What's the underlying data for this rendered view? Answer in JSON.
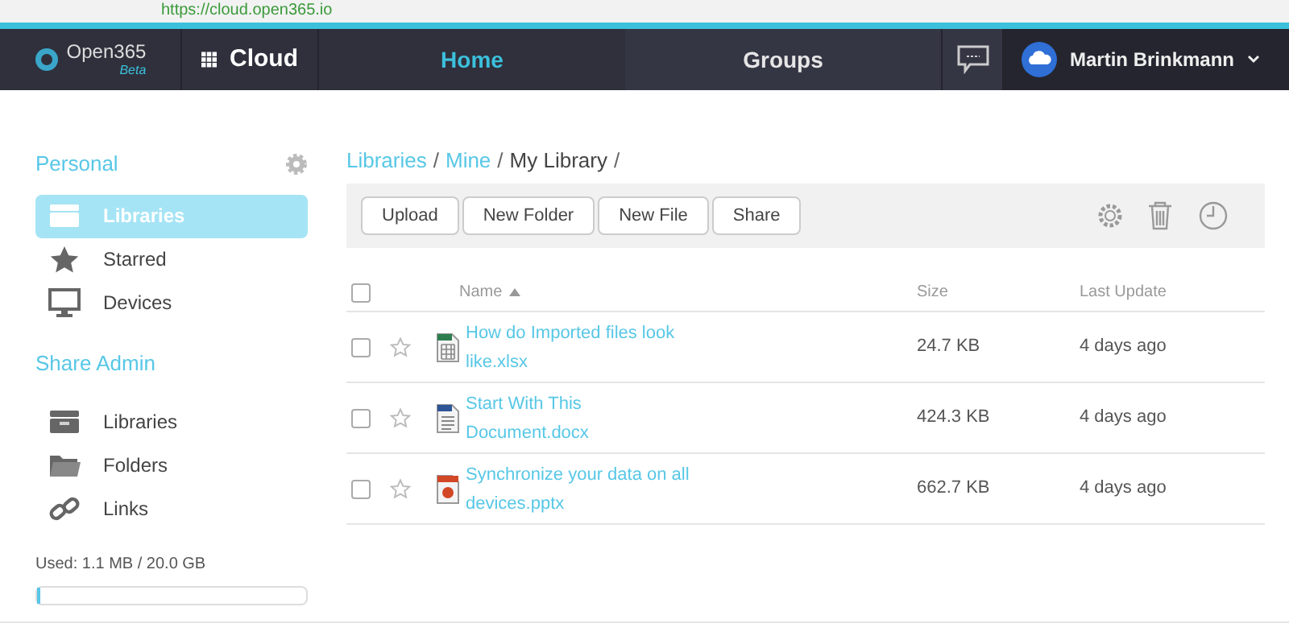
{
  "browser": {
    "url": "https://cloud.open365.io"
  },
  "nav": {
    "logo": "Open365",
    "logo_badge": "Beta",
    "app": "Cloud",
    "tabs": [
      {
        "label": "Home",
        "selected": true
      },
      {
        "label": "Groups",
        "selected": false
      }
    ],
    "user": "Martin Brinkmann"
  },
  "sidebar": {
    "sections": [
      {
        "title": "Personal",
        "items": [
          {
            "label": "Libraries",
            "kind": "drawer",
            "selected": true
          },
          {
            "label": "Starred",
            "kind": "star",
            "selected": false
          },
          {
            "label": "Devices",
            "kind": "monitor",
            "selected": false
          }
        ]
      },
      {
        "title": "Share Admin",
        "items": [
          {
            "label": "Libraries",
            "kind": "drawer",
            "selected": false
          },
          {
            "label": "Folders",
            "kind": "folder",
            "selected": false
          },
          {
            "label": "Links",
            "kind": "link",
            "selected": false
          }
        ]
      }
    ],
    "usage": {
      "text": "Used: 1.1 MB / 20.0 GB",
      "level": 0.01
    }
  },
  "breadcrumb": [
    {
      "label": "Libraries",
      "kind": "link",
      "separator": "/"
    },
    {
      "label": "Mine",
      "kind": "link",
      "separator": "/"
    },
    {
      "label": "My Library",
      "kind": "current",
      "separator": "/"
    }
  ],
  "toolbar": {
    "buttons": [
      "Upload",
      "New Folder",
      "New File",
      "Share"
    ]
  },
  "table": {
    "select_all": {
      "checked": false
    },
    "columns": [
      "Name",
      "Size",
      "Last Update"
    ],
    "rows": [
      {
        "name_lines": [
          "How do Imported files look",
          "like.xlsx"
        ],
        "kind": "spreadsheet",
        "size": "24.7 KB",
        "updated": "4 days ago",
        "checked": false,
        "starred": false
      },
      {
        "name_lines": [
          "Start With This",
          "Document.docx"
        ],
        "kind": "document",
        "size": "424.3 KB",
        "updated": "4 days ago",
        "checked": false,
        "starred": false
      },
      {
        "name_lines": [
          "Synchronize your data on all",
          "devices.pptx"
        ],
        "kind": "presentation",
        "size": "662.7 KB",
        "updated": "4 days ago",
        "checked": false,
        "starred": false
      }
    ]
  }
}
